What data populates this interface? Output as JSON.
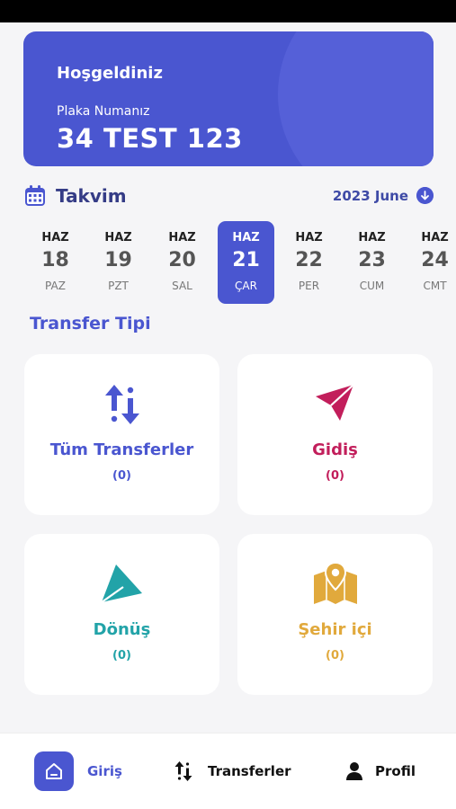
{
  "welcome": {
    "title": "Hoşgeldiniz",
    "plate_label": "Plaka Numanız",
    "plate": "34 TEST 123"
  },
  "calendar": {
    "title": "Takvim",
    "month": "2023 June",
    "days": [
      {
        "month": "HAZ",
        "num": "18",
        "weekday": "PAZ"
      },
      {
        "month": "HAZ",
        "num": "19",
        "weekday": "PZT"
      },
      {
        "month": "HAZ",
        "num": "20",
        "weekday": "SAL"
      },
      {
        "month": "HAZ",
        "num": "21",
        "weekday": "ÇAR",
        "selected": true
      },
      {
        "month": "HAZ",
        "num": "22",
        "weekday": "PER"
      },
      {
        "month": "HAZ",
        "num": "23",
        "weekday": "CUM"
      },
      {
        "month": "HAZ",
        "num": "24",
        "weekday": "CMT"
      }
    ]
  },
  "transfer": {
    "section_title": "Transfer Tipi",
    "cards": [
      {
        "label": "Tüm Transferler",
        "count": "(0)",
        "color": "#4a56d0",
        "icon": "swap-arrows-icon"
      },
      {
        "label": "Gidiş",
        "count": "(0)",
        "color": "#c21e5b",
        "icon": "send-arrow-icon"
      },
      {
        "label": "Dönüş",
        "count": "(0)",
        "color": "#22a3a8",
        "icon": "return-arrow-icon"
      },
      {
        "label": "Şehir içi",
        "count": "(0)",
        "color": "#e1a93c",
        "icon": "map-pin-icon"
      }
    ]
  },
  "nav": {
    "home": "Giriş",
    "transfers": "Transferler",
    "profile": "Profil"
  },
  "colors": {
    "accent": "#4a56d0"
  }
}
